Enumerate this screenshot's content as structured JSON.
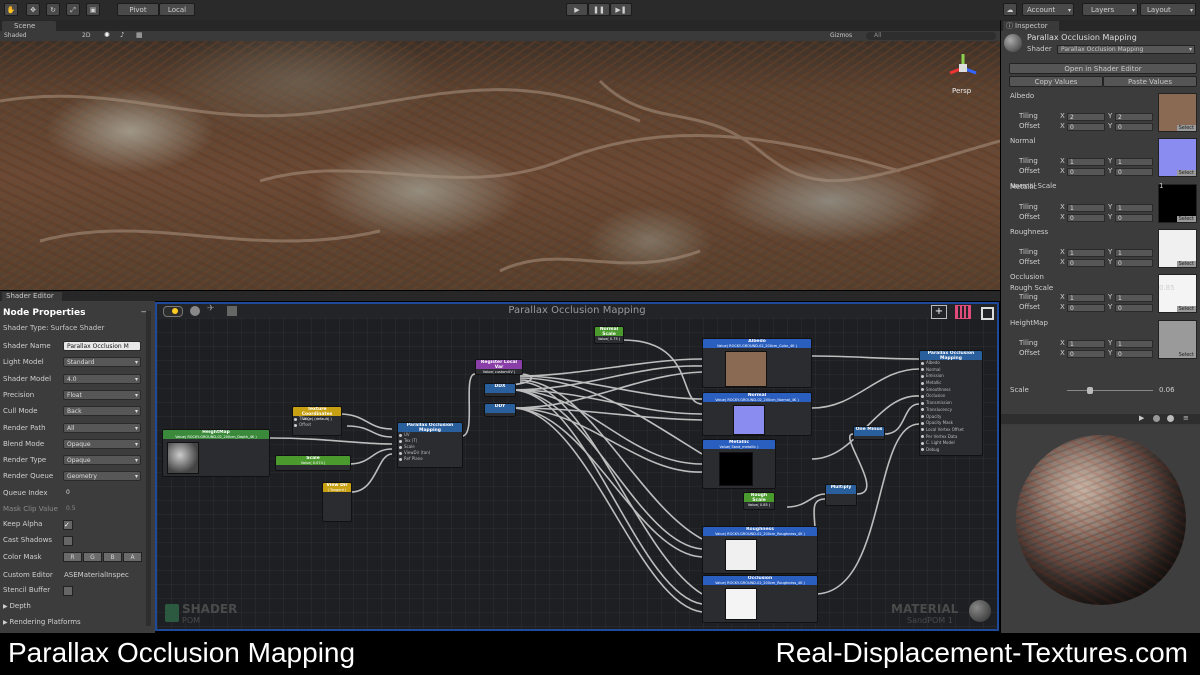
{
  "toolbar": {
    "pivot": "Pivot",
    "local": "Local",
    "account": "Account",
    "layers": "Layers",
    "layout": "Layout"
  },
  "scene": {
    "tab": "Scene",
    "shading": "Shaded",
    "mode2d": "2D",
    "gizmos": "Gizmos",
    "search": "All",
    "persp": "Persp"
  },
  "shader_editor": {
    "tab": "Shader Editor",
    "panel_title": "Node Properties",
    "shader_type": "Shader Type: Surface Shader",
    "props": [
      {
        "label": "Shader Name",
        "value": "Parallax Occlusion M"
      },
      {
        "label": "Light Model",
        "value": "Standard"
      },
      {
        "label": "Shader Model",
        "value": "4.0"
      },
      {
        "label": "Precision",
        "value": "Float"
      },
      {
        "label": "Cull Mode",
        "value": "Back"
      },
      {
        "label": "Render Path",
        "value": "All"
      },
      {
        "label": "Blend Mode",
        "value": "Opaque"
      },
      {
        "label": "Render Type",
        "value": "Opaque"
      },
      {
        "label": "Render Queue",
        "value": "Geometry"
      },
      {
        "label": "Queue Index",
        "value": "0"
      },
      {
        "label": "Mask Clip Value",
        "value": "0.5"
      }
    ],
    "keep_alpha": "Keep Alpha",
    "cast_shadows": "Cast Shadows",
    "color_mask": "Color Mask",
    "color_mask_channels": [
      "R",
      "G",
      "B",
      "A"
    ],
    "custom_editor": "Custom Editor",
    "custom_editor_value": "ASEMaterialInspec",
    "stencil_buffer": "Stencil Buffer",
    "depth": "Depth",
    "rendering_platforms": "Rendering Platforms",
    "canvas_title": "Parallax Occlusion Mapping",
    "shader_watermark": "SHADER",
    "shader_sub": "POM",
    "material_watermark": "MATERIAL",
    "material_sub": "SandPOM 1",
    "nodes": {
      "heightmap": "HeightMap",
      "heightmap_sub": "Value( ROCKY-GROUND-02_200cm_Depth_4K )",
      "texcoords": "Texture Coordinates",
      "texcoords_sub": "Value( (default) )",
      "texcoords_ports": [
        "Tiling",
        "Offset"
      ],
      "scale": "Scale",
      "scale_sub": "Value( 0.074 )",
      "viewdir": "View Dir",
      "viewdir_sub": "( Tangent )",
      "pom": "Parallax Occlusion Mapping",
      "pom_ports": [
        "UV",
        "Tex (T)",
        "Scale",
        "ViewDir (tan)",
        "Ref Plane"
      ],
      "register": "Register Local Var",
      "register_sub": "Value( customUV )",
      "ddx": "DDX",
      "ddy": "DDY",
      "normal_scale": "Normal Scale",
      "normal_scale_sub": "Value( 0.75 )",
      "albedo": "Albedo",
      "albedo_sub": "Value( ROCKY-GROUND-02_200cm_Color_4K )",
      "normal": "Normal",
      "normal_sub": "Value( ROCKY-GROUND-02_200cm_Normal_4K )",
      "metallic": "Metallic",
      "metallic_sub": "Value( Sand_metallic )",
      "rough_scale": "Rough Scale",
      "rough_scale_sub": "Value( 0.85 )",
      "roughness": "Roughness",
      "roughness_sub": "Value( ROCKY-GROUND-02_200cm_Roughness_4K )",
      "occlusion": "Occlusion",
      "occlusion_sub": "Value( ROCKY-GROUND-02_200cm_Roughness_4K )",
      "multiply": "Multiply",
      "one_minus": "One Minus",
      "sampler_ports": [
        "Tex",
        "UV",
        "DDX",
        "DDY"
      ],
      "rgba_ports": [
        "RGBA",
        "R",
        "G",
        "B",
        "A"
      ],
      "output": "Parallax Occlusion Mapping",
      "output_ports": [
        "Albedo",
        "Normal",
        "Emission",
        "Metallic",
        "Smoothness",
        "Occlusion",
        "Transmission",
        "Translucency",
        "Opacity",
        "Opacity Mask",
        "Local Vertex Offset",
        "Per Vertex Data",
        "C. Light Model",
        "Debug"
      ]
    }
  },
  "inspector": {
    "tab": "Inspector",
    "material_name": "Parallax Occlusion Mapping",
    "shader_label": "Shader",
    "shader_value": "Parallax Occlusion Mapping",
    "open_button": "Open in Shader Editor",
    "copy_button": "Copy Values",
    "paste_button": "Paste Values",
    "select": "Select",
    "textures": [
      {
        "name": "Albedo",
        "tx": "2",
        "ty": "2",
        "ox": "0",
        "oy": "0",
        "color": "#8a6a52"
      },
      {
        "name": "Normal",
        "tx": "1",
        "ty": "1",
        "ox": "0",
        "oy": "0",
        "color": "#8a8cf0"
      },
      {
        "name": "Metallic",
        "tx": "1",
        "ty": "1",
        "ox": "0",
        "oy": "0",
        "color": "#000000"
      },
      {
        "name": "Roughness",
        "tx": "1",
        "ty": "1",
        "ox": "0",
        "oy": "0",
        "color": "#f0f0f0"
      },
      {
        "name": "Occlusion",
        "tx": "1",
        "ty": "1",
        "ox": "0",
        "oy": "0",
        "color": "#f4f4f4"
      },
      {
        "name": "HeightMap",
        "tx": "1",
        "ty": "1",
        "ox": "0",
        "oy": "0",
        "color": "#9a9a9a"
      }
    ],
    "normal_scale_label": "Normal Scale",
    "normal_scale_value": "1",
    "rough_scale_label": "Rough Scale",
    "rough_scale_value": "0.85",
    "scale_label": "Scale",
    "scale_value": "0.06",
    "tiling": "Tiling",
    "offset": "Offset",
    "x": "X",
    "y": "Y"
  },
  "captions": {
    "left": "Parallax Occlusion Mapping",
    "right": "Real-Displacement-Textures.com"
  }
}
